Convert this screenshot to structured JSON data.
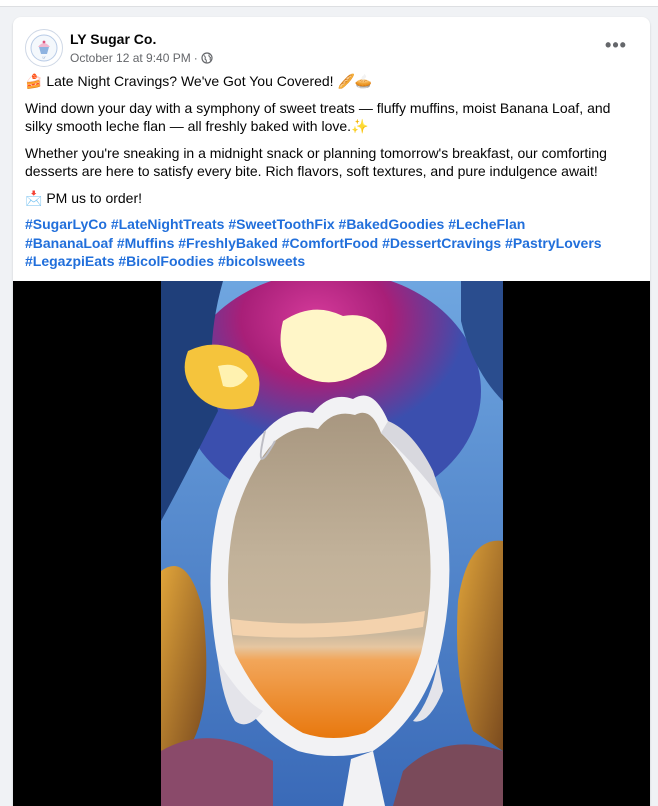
{
  "post": {
    "author": "LY Sugar Co.",
    "timestamp": "October 12 at 9:40 PM",
    "separator": "·",
    "audience_icon": "globe-icon",
    "more_icon": "more-options-icon",
    "more_label": "•••",
    "line1": "🍰 Late Night Cravings? We've Got You Covered! 🥖🥧",
    "line2": "Wind down your day with a symphony of sweet treats — fluffy muffins, moist Banana Loaf, and silky smooth leche flan — all freshly baked with love.✨",
    "line3": "Whether you're sneaking in a midnight snack or planning tomorrow's breakfast, our comforting desserts are here to satisfy every bite. Rich flavors, soft textures, and pure indulgence await!",
    "line4": "📩 PM us to order!",
    "hashtags": [
      "#SugarLyCo",
      "#LateNightTreats",
      "#SweetToothFix",
      "#BakedGoodies",
      "#LecheFlan",
      "#BananaLoaf",
      "#Muffins",
      "#FreshlyBaked",
      "#ComfortFood",
      "#DessertCravings",
      "#PastryLovers",
      "#LegazpiEats",
      "#BicolFoodies",
      "#bicolsweets"
    ]
  },
  "colors": {
    "link": "#216fdb",
    "secondary_text": "#65676b",
    "background": "#f0f2f5"
  }
}
